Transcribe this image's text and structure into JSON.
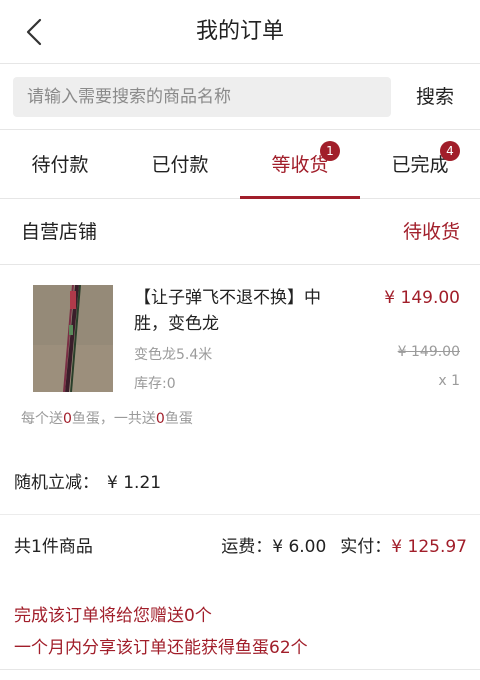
{
  "header": {
    "title": "我的订单",
    "back_icon": "chevron-left-icon"
  },
  "search": {
    "placeholder": "请输入需要搜索的商品名称",
    "button_label": "搜索"
  },
  "tabs": [
    {
      "label": "待付款",
      "badge": ""
    },
    {
      "label": "已付款",
      "badge": ""
    },
    {
      "label": "等收货",
      "badge": "1",
      "active": true
    },
    {
      "label": "已完成",
      "badge": "4"
    }
  ],
  "order": {
    "shop_name": "自营店铺",
    "status": "待收货",
    "product": {
      "title": "【让子弹飞不退不换】中胜，变色龙",
      "price": "¥ 149.00",
      "spec": "变色龙5.4米",
      "original_price": "¥ 149.00",
      "stock": "库存:0",
      "quantity": "x 1"
    },
    "gift_note": {
      "prefix": "每个送",
      "each": "0",
      "middle": "鱼蛋，一共送",
      "total": "0",
      "suffix": "鱼蛋"
    },
    "discount": {
      "label": "随机立减：",
      "value": "¥ 1.21"
    },
    "summary": {
      "items": "共1件商品",
      "shipping_label": "运费：",
      "shipping_value": "¥ 6.00",
      "paid_label": "实付：",
      "paid_value": "¥ 125.97"
    },
    "promo": [
      "完成该订单将给您赠送0个",
      "一个月内分享该订单还能获得鱼蛋62个"
    ]
  },
  "colors": {
    "accent": "#a11e2a",
    "muted": "#9b9b9b"
  }
}
